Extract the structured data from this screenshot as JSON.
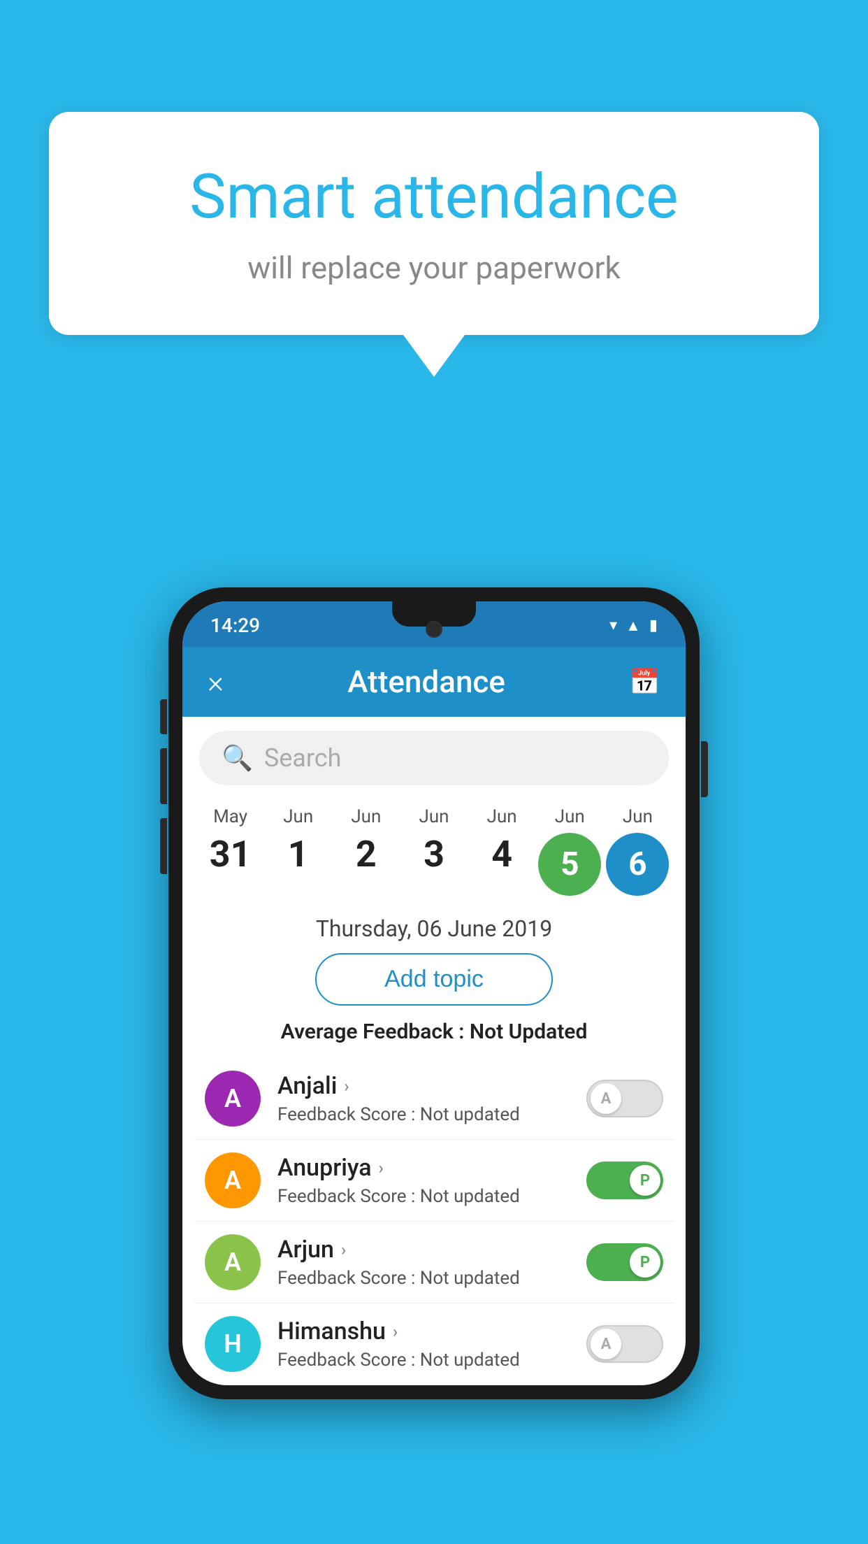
{
  "background_color": "#29b6e8",
  "speech_bubble": {
    "title": "Smart attendance",
    "subtitle": "will replace your paperwork"
  },
  "status_bar": {
    "time": "14:29",
    "icons": [
      "wifi",
      "signal",
      "battery"
    ]
  },
  "app_header": {
    "title": "Attendance",
    "close_label": "×",
    "calendar_icon": "📅"
  },
  "search": {
    "placeholder": "Search"
  },
  "dates": [
    {
      "month": "May",
      "day": "31",
      "selected": false
    },
    {
      "month": "Jun",
      "day": "1",
      "selected": false
    },
    {
      "month": "Jun",
      "day": "2",
      "selected": false
    },
    {
      "month": "Jun",
      "day": "3",
      "selected": false
    },
    {
      "month": "Jun",
      "day": "4",
      "selected": false
    },
    {
      "month": "Jun",
      "day": "5",
      "selected": "green"
    },
    {
      "month": "Jun",
      "day": "6",
      "selected": "blue"
    }
  ],
  "selected_date_label": "Thursday, 06 June 2019",
  "add_topic_label": "Add topic",
  "average_feedback": {
    "label": "Average Feedback :",
    "value": "Not Updated"
  },
  "students": [
    {
      "name": "Anjali",
      "initial": "A",
      "avatar_color": "purple",
      "feedback_label": "Feedback Score :",
      "feedback_value": "Not updated",
      "toggle_state": "off",
      "toggle_letter": "A"
    },
    {
      "name": "Anupriya",
      "initial": "A",
      "avatar_color": "orange",
      "feedback_label": "Feedback Score :",
      "feedback_value": "Not updated",
      "toggle_state": "on",
      "toggle_letter": "P"
    },
    {
      "name": "Arjun",
      "initial": "A",
      "avatar_color": "green",
      "feedback_label": "Feedback Score :",
      "feedback_value": "Not updated",
      "toggle_state": "on",
      "toggle_letter": "P"
    },
    {
      "name": "Himanshu",
      "initial": "H",
      "avatar_color": "teal",
      "feedback_label": "Feedback Score :",
      "feedback_value": "Not updated",
      "toggle_state": "off",
      "toggle_letter": "A"
    }
  ]
}
